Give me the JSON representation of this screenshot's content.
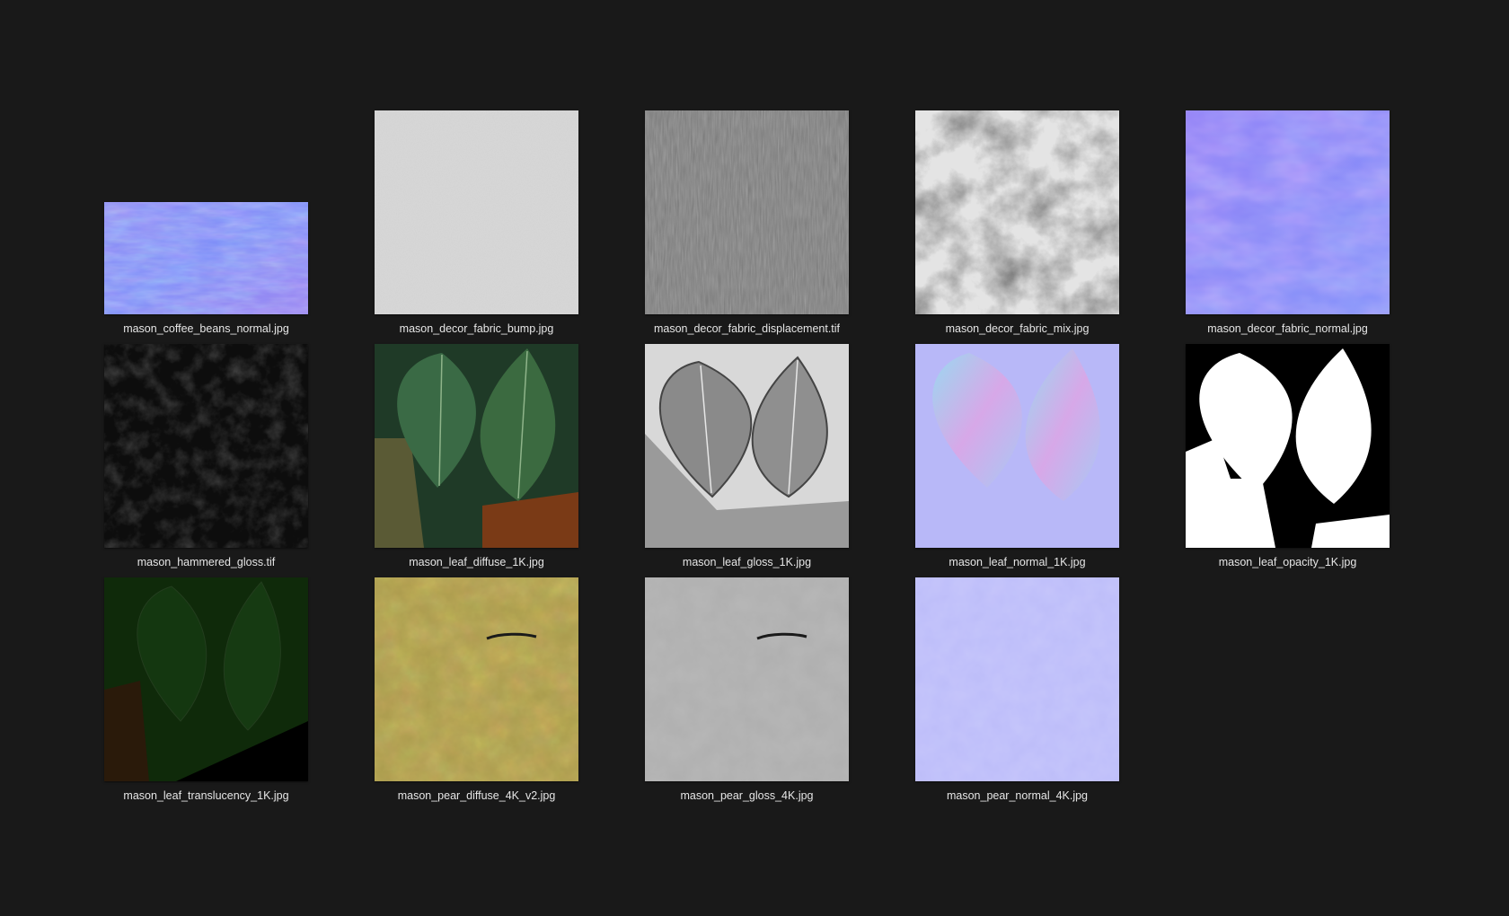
{
  "files": [
    {
      "name": "mason_coffee_beans_normal.jpg",
      "texture": "normal-map-wavy"
    },
    {
      "name": "mason_decor_fabric_bump.jpg",
      "texture": "light-gray-noise"
    },
    {
      "name": "mason_decor_fabric_displacement.tif",
      "texture": "gray-fabric"
    },
    {
      "name": "mason_decor_fabric_mix.jpg",
      "texture": "gray-cloudy"
    },
    {
      "name": "mason_decor_fabric_normal.jpg",
      "texture": "normal-map-creased"
    },
    {
      "name": "mason_hammered_gloss.tif",
      "texture": "dark-noise"
    },
    {
      "name": "mason_leaf_diffuse_1K.jpg",
      "texture": "green-leaves"
    },
    {
      "name": "mason_leaf_gloss_1K.jpg",
      "texture": "gray-leaves"
    },
    {
      "name": "mason_leaf_normal_1K.jpg",
      "texture": "normal-leaves"
    },
    {
      "name": "mason_leaf_opacity_1K.jpg",
      "texture": "white-leaf-mask"
    },
    {
      "name": "mason_leaf_translucency_1K.jpg",
      "texture": "dark-green-leaves"
    },
    {
      "name": "mason_pear_diffuse_4K_v2.jpg",
      "texture": "yellow-orange-pear-skin"
    },
    {
      "name": "mason_pear_gloss_4K.jpg",
      "texture": "gray-pear-skin"
    },
    {
      "name": "mason_pear_normal_4K.jpg",
      "texture": "flat-normal-map"
    }
  ],
  "colors": {
    "background": "#191919",
    "caption": "#e6e6e6"
  }
}
